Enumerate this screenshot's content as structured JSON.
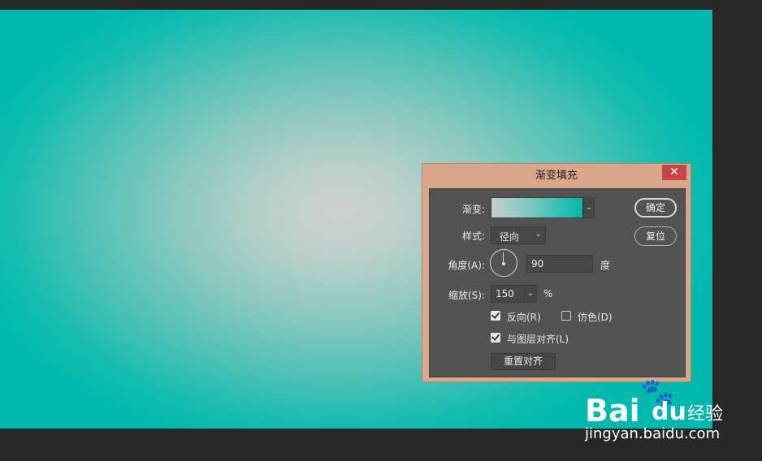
{
  "dialog": {
    "title": "渐变填充",
    "close_glyph": "✕",
    "fields": {
      "gradient_label": "渐变:",
      "style_label": "样式:",
      "style_value": "径向",
      "angle_label": "角度(A):",
      "angle_value": "90",
      "angle_unit": "度",
      "scale_label": "缩放(S):",
      "scale_value": "150",
      "scale_unit": "%"
    },
    "options": {
      "reverse_label": "反向(R)",
      "reverse_checked": true,
      "dither_label": "仿色(D)",
      "dither_checked": false,
      "align_label": "与图层对齐(L)",
      "align_checked": true
    },
    "buttons": {
      "ok": "确定",
      "reset": "复位",
      "reset_align": "重置对齐"
    },
    "colors": {
      "title_bar": "#d8a68a",
      "close_button": "#c94545",
      "panel": "#535353",
      "gradient_start": "#c3cfcc",
      "gradient_end": "#00b8aa"
    }
  },
  "watermark": {
    "brand_bai": "Bai",
    "brand_du": "du",
    "brand_suffix": "经验",
    "url": "jingyan.baidu.com"
  },
  "icons": {
    "chevron": "⌄",
    "paw": "🐾"
  }
}
